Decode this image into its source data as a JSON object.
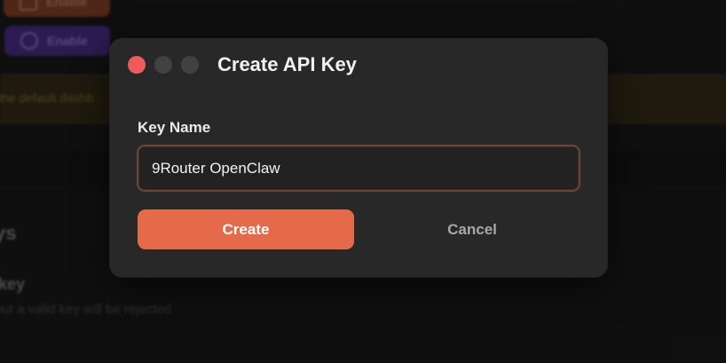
{
  "background": {
    "top_button_label": "Enable",
    "enable_button_label": "Enable",
    "warning_text": "the default dashb",
    "section_title": "ys",
    "key_label": "key",
    "key_description": "out a valid key will be rejected"
  },
  "modal": {
    "title": "Create API Key",
    "field_label": "Key Name",
    "key_name_value": "9Router OpenClaw",
    "create_label": "Create",
    "cancel_label": "Cancel"
  },
  "colors": {
    "accent": "#e46a4a",
    "close_dot": "#ef5b5b",
    "modal_bg": "#282828",
    "enable_purple": "#3e2670"
  },
  "icons": {
    "window_controls": [
      "close-dot",
      "minimize-dot",
      "maximize-dot"
    ],
    "background": [
      "square-icon",
      "globe-icon"
    ]
  }
}
